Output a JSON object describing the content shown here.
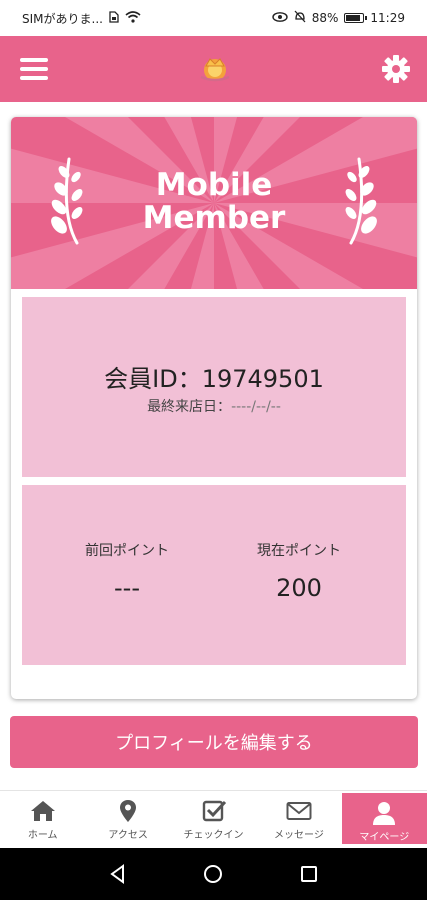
{
  "status_bar": {
    "carrier": "SIMがありま...",
    "battery": "88%",
    "battery_level": 0.88,
    "time": "11:29"
  },
  "app_bar": {
    "menu_icon": "hamburger-menu-icon",
    "logo_icon": "crown-logo-icon",
    "settings_icon": "gear-icon"
  },
  "card": {
    "header_title_line1": "Mobile",
    "header_title_line2": "Member",
    "member_id_label": "会員ID：",
    "member_id_value": "19749501",
    "last_visit_label": "最終来店日：",
    "last_visit_value": "----/--/--",
    "points": {
      "previous_label": "前回ポイント",
      "previous_value": "---",
      "current_label": "現在ポイント",
      "current_value": "200"
    }
  },
  "edit_profile_button": "プロフィールを編集する",
  "bottom_nav": {
    "items": [
      {
        "label": "ホーム",
        "icon": "home-icon"
      },
      {
        "label": "アクセス",
        "icon": "map-pin-icon"
      },
      {
        "label": "チェックイン",
        "icon": "checkbox-icon"
      },
      {
        "label": "メッセージ",
        "icon": "envelope-icon"
      },
      {
        "label": "マイページ",
        "icon": "user-icon"
      }
    ],
    "active_index": 4
  },
  "colors": {
    "primary": "#e8638b",
    "panel": "#f2c0d6",
    "header_rays": "#ee7fa2"
  },
  "system_nav": {
    "icons": [
      "back-icon",
      "home-circle-icon",
      "recents-icon"
    ]
  }
}
